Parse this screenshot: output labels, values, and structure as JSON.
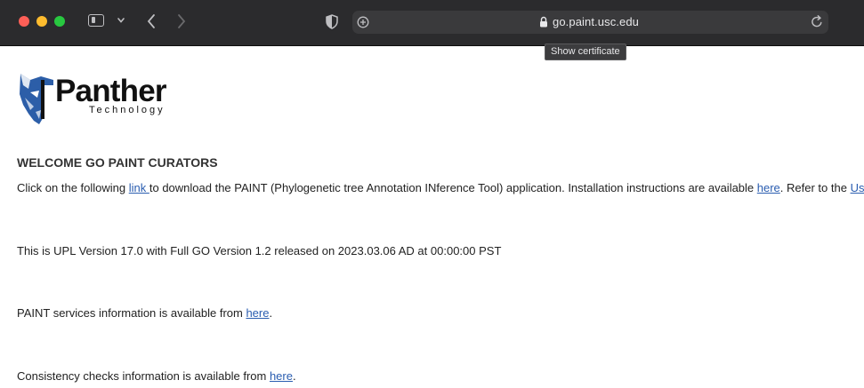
{
  "browser": {
    "url": "go.paint.usc.edu",
    "tooltip": "Show certificate",
    "icons": {
      "sidebar": "sidebar-icon",
      "menu": "chevron-down-icon",
      "back": "chevron-left-icon",
      "forward": "chevron-right-icon",
      "privacy": "shield-icon",
      "new_tab": "plus-circle-icon",
      "lock": "lock-icon",
      "reload": "reload-icon"
    }
  },
  "logo": {
    "word": "Panther",
    "sub": "Technology"
  },
  "page": {
    "heading": "WELCOME GO PAINT CURATORS",
    "line1": {
      "pre": "Click on the following ",
      "link1": "link ",
      "mid": "to download the PAINT (Phylogenetic tree Annotation INference Tool) application. Installation instructions are available ",
      "link2": "here",
      "post": ". Refer to the ",
      "link3": "Us"
    },
    "line2": "This is UPL Version 17.0 with Full GO Version 1.2 released on 2023.03.06 AD at 00:00:00 PST",
    "line3": {
      "pre": "PAINT services information is available from ",
      "link": "here",
      "post": "."
    },
    "line4": {
      "pre": "Consistency checks information is available from ",
      "link": "here",
      "post": "."
    }
  }
}
